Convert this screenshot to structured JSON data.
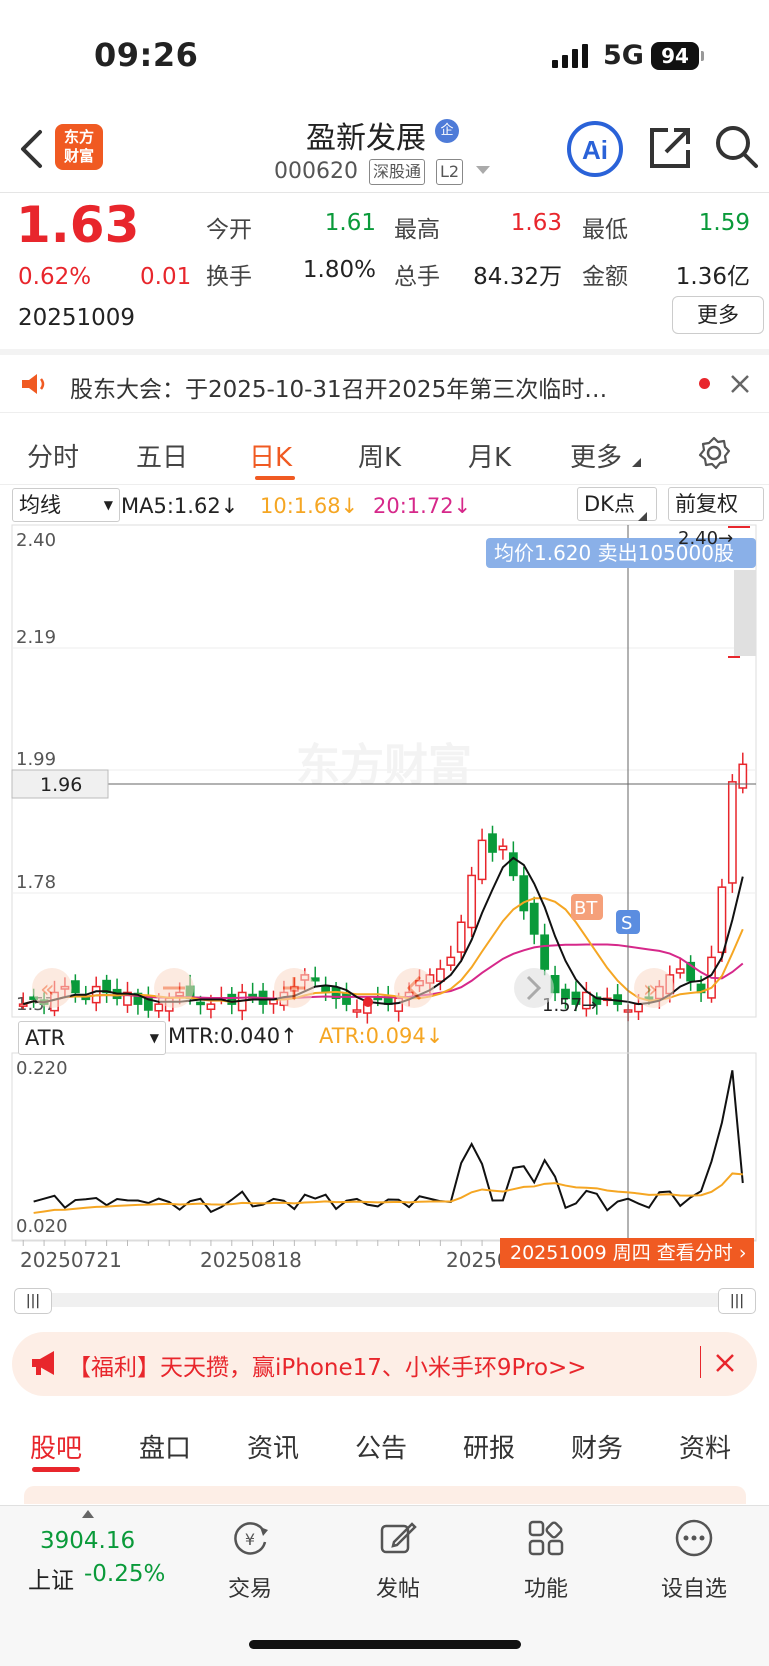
{
  "status": {
    "time": "09:26",
    "network": "5G",
    "battery": "94"
  },
  "header": {
    "logo_line1": "东方",
    "logo_line2": "财富",
    "title": "盈新发展",
    "badge": "企",
    "code": "000620",
    "tag1": "深股通",
    "tag2": "L2",
    "ai": "Ai"
  },
  "quote": {
    "price": "1.63",
    "change_pct": "0.62%",
    "change": "0.01",
    "date": "20251009",
    "fields": [
      {
        "label": "今开",
        "value": "1.61",
        "color": "green"
      },
      {
        "label": "最高",
        "value": "1.63",
        "color": "red"
      },
      {
        "label": "最低",
        "value": "1.59",
        "color": "green"
      },
      {
        "label": "换手",
        "value": "1.80%",
        "color": "black"
      },
      {
        "label": "总手",
        "value": "84.32万",
        "color": "black"
      },
      {
        "label": "金额",
        "value": "1.36亿",
        "color": "black"
      }
    ],
    "more": "更多"
  },
  "notice": "股东大会：于2025-10-31召开2025年第三次临时…",
  "tabs": [
    "分时",
    "五日",
    "日K",
    "周K",
    "月K",
    "更多"
  ],
  "active_tab": "日K",
  "kline": {
    "indicator_select": "均线",
    "ma5": "MA5:1.62↓",
    "ma10": "10:1.68↓",
    "ma20": "20:1.72↓",
    "dk_button": "DK点",
    "adjust_button": "前复权",
    "y_labels": [
      "2.40",
      "2.19",
      "1.99",
      "1.78",
      "1.57"
    ],
    "crosshair_price": "1.96",
    "tooltip": "均价1.620 卖出105000股",
    "max_marker": "2.40→",
    "min_marker": "1.57→",
    "watermark": "东方财富",
    "marker_bt": "BT",
    "marker_s": "S"
  },
  "atr": {
    "select": "ATR",
    "mtr": "MTR:0.040↑",
    "atr": "ATR:0.094↓",
    "y_labels": [
      "0.220",
      "0.020"
    ]
  },
  "x_labels": [
    "20250721",
    "20250818",
    "20250"
  ],
  "date_tip": "20251009 周四 查看分时",
  "promo": "【福利】天天攒，赢iPhone17、小米手环9Pro>>",
  "bottom_tabs": [
    "股吧",
    "盘口",
    "资讯",
    "公告",
    "研报",
    "财务",
    "资料"
  ],
  "footer": {
    "index_value": "3904.16",
    "index_name": "上证",
    "index_change": "-0.25%",
    "items": [
      "交易",
      "发帖",
      "功能",
      "设自选"
    ]
  },
  "colors": {
    "up": "#e8262c",
    "down": "#0a9a3a",
    "accent": "#f05a22",
    "ma10": "#f5a623",
    "ma20": "#d6288a"
  }
}
